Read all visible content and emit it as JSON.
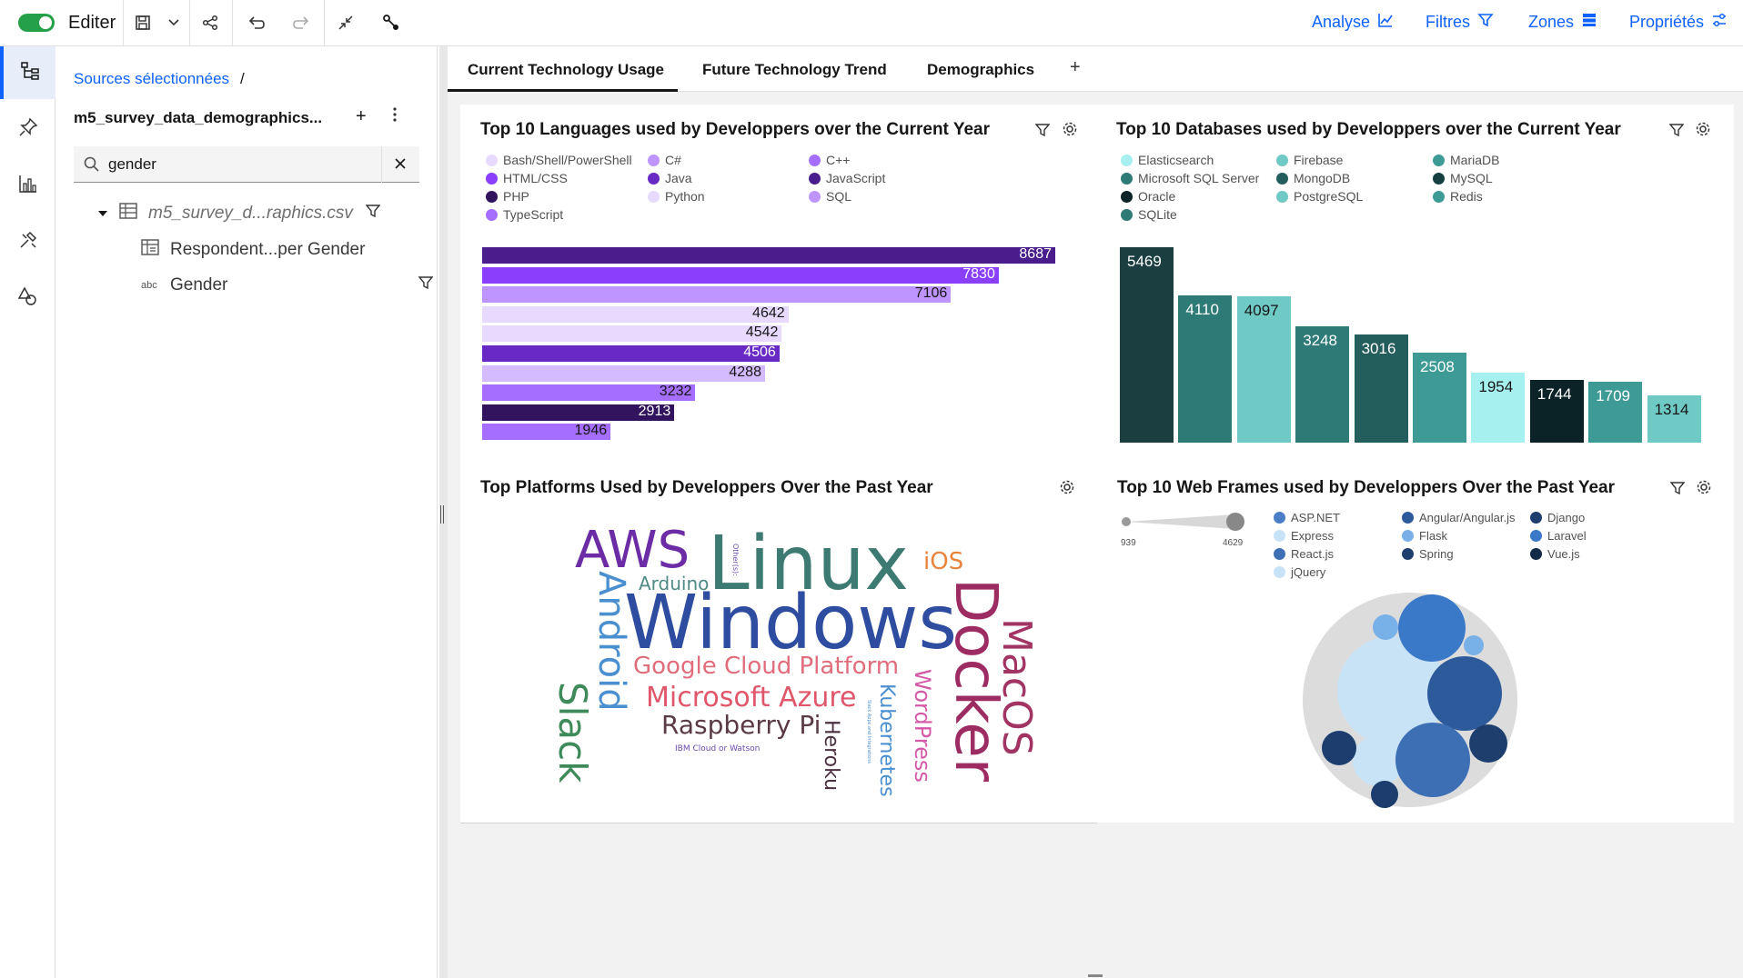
{
  "topbar": {
    "edit_label": "Editer",
    "nav": {
      "analyse": "Analyse",
      "filters": "Filtres",
      "zones": "Zones",
      "properties": "Propriétés"
    }
  },
  "datapanel": {
    "breadcrumb": "Sources sélectionnées",
    "breadcrumb_sep": "/",
    "source_name": "m5_survey_data_demographics...",
    "search": {
      "value": "gender",
      "placeholder": ""
    },
    "tree": {
      "file": "m5_survey_d...raphics.csv",
      "item1": "Respondent...per Gender",
      "item2": "Gender",
      "item2_type": "abc"
    }
  },
  "tabs": [
    {
      "label": "Current Technology Usage"
    },
    {
      "label": "Future Technology Trend"
    },
    {
      "label": "Demographics"
    }
  ],
  "tab_add": "+",
  "colors": {
    "accent": "#0f62fe",
    "purple_dark": "#491d8b",
    "teal_dark": "#1b3f40"
  },
  "cards": {
    "languages": {
      "title": "Top 10 Languages used by Developpers over the Current Year",
      "legend": [
        {
          "name": "Bash/Shell/PowerShell",
          "color": "#e8daff"
        },
        {
          "name": "C#",
          "color": "#be95ff"
        },
        {
          "name": "C++",
          "color": "#a56eff"
        },
        {
          "name": "HTML/CSS",
          "color": "#8a3ffc"
        },
        {
          "name": "Java",
          "color": "#6929c4"
        },
        {
          "name": "JavaScript",
          "color": "#491d8b"
        },
        {
          "name": "PHP",
          "color": "#31135e"
        },
        {
          "name": "Python",
          "color": "#e8daff"
        },
        {
          "name": "SQL",
          "color": "#be95ff"
        },
        {
          "name": "TypeScript",
          "color": "#a56eff"
        }
      ]
    },
    "databases": {
      "title": "Top 10 Databases used by Developpers over the Current Year",
      "legend": [
        {
          "name": "Elasticsearch",
          "color": "#a7f0f0"
        },
        {
          "name": "Firebase",
          "color": "#6fc9c5"
        },
        {
          "name": "MariaDB",
          "color": "#3d9a95"
        },
        {
          "name": "Microsoft SQL Server",
          "color": "#2e7a77"
        },
        {
          "name": "MongoDB",
          "color": "#235d5c"
        },
        {
          "name": "MySQL",
          "color": "#163f41"
        },
        {
          "name": "Oracle",
          "color": "#0b2326"
        },
        {
          "name": "PostgreSQL",
          "color": "#6fc9c5"
        },
        {
          "name": "Redis",
          "color": "#3d9a95"
        },
        {
          "name": "SQLite",
          "color": "#2e7a77"
        }
      ]
    },
    "platforms": {
      "title": "Top Platforms Used by Developpers Over the Past Year",
      "words": [
        {
          "text": "Windows",
          "color": "#2e4da0"
        },
        {
          "text": "Linux",
          "color": "#3d7a72"
        },
        {
          "text": "Docker",
          "color": "#9d2c63"
        },
        {
          "text": "AWS",
          "color": "#6b2ca5"
        },
        {
          "text": "MacOS",
          "color": "#a23463"
        },
        {
          "text": "Android",
          "color": "#4a8fd0"
        },
        {
          "text": "Slack",
          "color": "#3f8a5a"
        },
        {
          "text": "Google Cloud Platform",
          "color": "#e06c7c"
        },
        {
          "text": "Microsoft Azure",
          "color": "#e0566b"
        },
        {
          "text": "Raspberry Pi",
          "color": "#5a3a44"
        },
        {
          "text": "Kubernetes",
          "color": "#4a8fd0"
        },
        {
          "text": "WordPress",
          "color": "#d45aa8"
        },
        {
          "text": "Heroku",
          "color": "#4a3040"
        },
        {
          "text": "iOS",
          "color": "#e8853c"
        },
        {
          "text": "Arduino",
          "color": "#4f8a86"
        },
        {
          "text": "IBM Cloud or Watson",
          "color": "#6b4ab0"
        },
        {
          "text": "Other(s):",
          "color": "#6b4ab0"
        },
        {
          "text": "Slack Apps and Integrations",
          "color": "#4a8fd0"
        }
      ]
    },
    "webframes": {
      "title": "Top 10 Web Frames used by Developpers Over the Past Year",
      "slider_min": "939",
      "slider_max": "4629",
      "legend": [
        {
          "name": "ASP.NET",
          "color": "#4a7fc8"
        },
        {
          "name": "Angular/Angular.js",
          "color": "#2d5a9a"
        },
        {
          "name": "Django",
          "color": "#1c3d6e"
        },
        {
          "name": "Express",
          "color": "#c8e2f6"
        },
        {
          "name": "Flask",
          "color": "#78b0e8"
        },
        {
          "name": "Laravel",
          "color": "#3a78c8"
        },
        {
          "name": "React.js",
          "color": "#3d6fb5"
        },
        {
          "name": "Spring",
          "color": "#1e3f6e"
        },
        {
          "name": "Vue.js",
          "color": "#112a48"
        },
        {
          "name": "jQuery",
          "color": "#c8e2f6"
        }
      ]
    }
  },
  "chart_data": [
    {
      "type": "bar",
      "orientation": "horizontal",
      "title": "Top 10 Languages used by Developpers over the Current Year",
      "values": [
        8687,
        7830,
        7106,
        4642,
        4542,
        4506,
        4288,
        3232,
        2913,
        1946
      ],
      "colors": [
        "#491d8b",
        "#8a3ffc",
        "#be95ff",
        "#e8daff",
        "#e8daff",
        "#6929c4",
        "#d4bbff",
        "#a56eff",
        "#31135e",
        "#a56eff"
      ],
      "xlim": [
        0,
        8687
      ]
    },
    {
      "type": "bar",
      "orientation": "vertical",
      "title": "Top 10 Databases used by Developpers over the Current Year",
      "values": [
        5469,
        4110,
        4097,
        3248,
        3016,
        2508,
        1954,
        1744,
        1709,
        1314
      ],
      "colors": [
        "#1b3f40",
        "#2e7a77",
        "#6fc9c5",
        "#2e7a77",
        "#235d5c",
        "#3d9a95",
        "#a7f0f0",
        "#0b2326",
        "#3d9a95",
        "#6fc9c5"
      ],
      "label_colors": [
        "#ffffff",
        "#ffffff",
        "#161616",
        "#ffffff",
        "#ffffff",
        "#ffffff",
        "#161616",
        "#ffffff",
        "#ffffff",
        "#161616"
      ],
      "ylim": [
        0,
        5469
      ]
    }
  ]
}
